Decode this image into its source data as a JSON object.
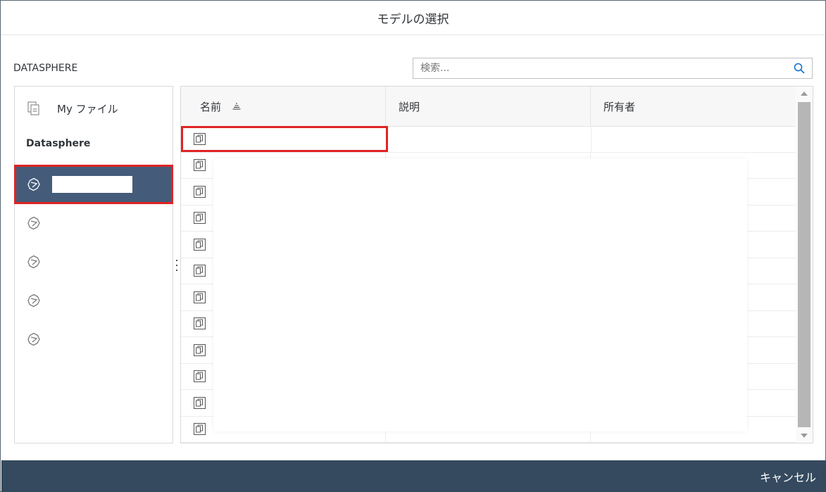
{
  "dialog": {
    "title": "モデルの選択"
  },
  "source": {
    "label": "DATASPHERE"
  },
  "search": {
    "placeholder": "検索..."
  },
  "sidebar": {
    "my_files_label": "My ファイル",
    "section_label": "Datasphere",
    "items": [
      {
        "label": "",
        "selected": true
      },
      {
        "label": "",
        "selected": false
      },
      {
        "label": "",
        "selected": false
      },
      {
        "label": "",
        "selected": false
      },
      {
        "label": "",
        "selected": false
      }
    ]
  },
  "table": {
    "columns": [
      "名前",
      "説明",
      "所有者"
    ],
    "sorted_column": "名前",
    "rows": [
      {
        "name": "",
        "description": "",
        "owner": ""
      },
      {
        "name": "",
        "description": "",
        "owner": ""
      },
      {
        "name": "",
        "description": "",
        "owner": ""
      },
      {
        "name": "",
        "description": "",
        "owner": ""
      },
      {
        "name": "",
        "description": "",
        "owner": ""
      },
      {
        "name": "",
        "description": "",
        "owner": ""
      },
      {
        "name": "",
        "description": "",
        "owner": ""
      },
      {
        "name": "",
        "description": "",
        "owner": ""
      },
      {
        "name": "",
        "description": "",
        "owner": ""
      },
      {
        "name": "",
        "description": "",
        "owner": ""
      },
      {
        "name": "",
        "description": "",
        "owner": ""
      },
      {
        "name": "",
        "description": "",
        "owner": ""
      }
    ]
  },
  "footer": {
    "cancel_label": "キャンセル"
  },
  "colors": {
    "footer_bg": "#354a5f",
    "selected_item_bg": "#445c7a",
    "highlight_border": "#e02424"
  }
}
